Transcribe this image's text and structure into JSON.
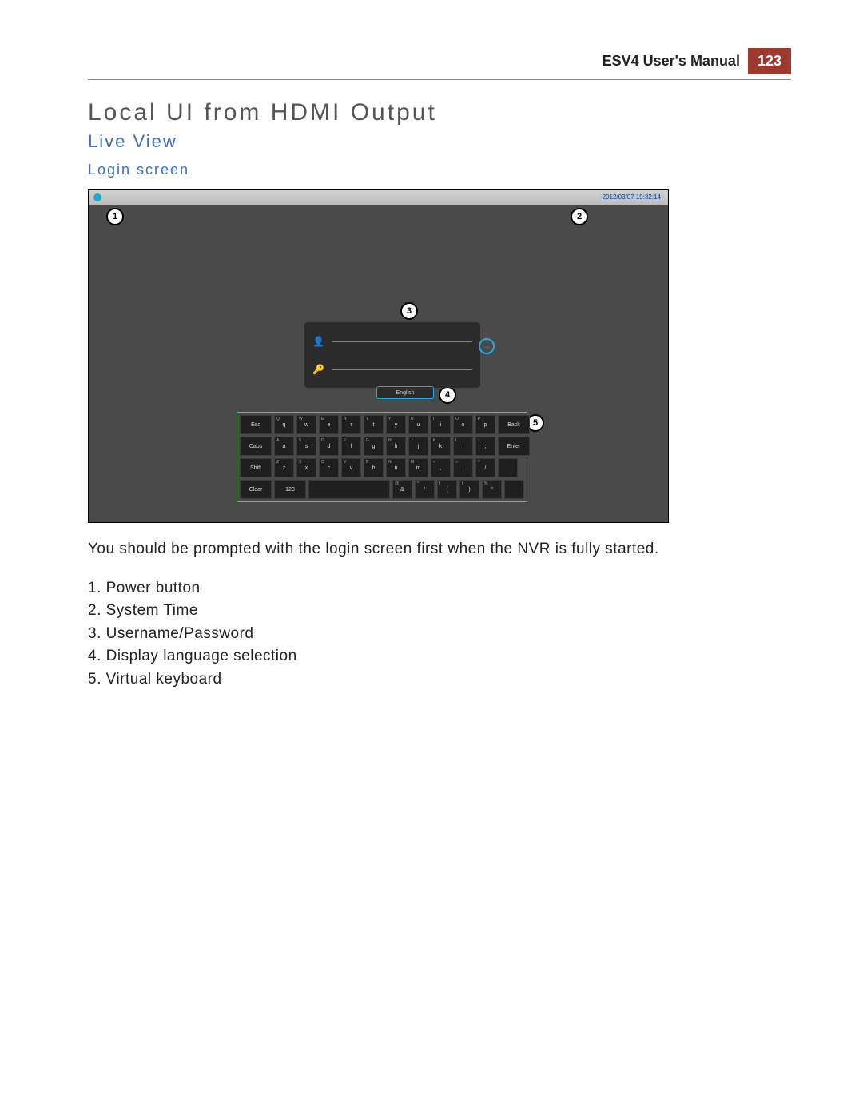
{
  "header": {
    "manual": "ESV4 User's Manual",
    "page": "123"
  },
  "titles": {
    "h1": "Local UI from HDMI Output",
    "h2": "Live View",
    "h3": "Login screen"
  },
  "screenshot": {
    "timestamp": "2012/03/07 19:32:14",
    "language": "English",
    "callouts": {
      "c1": "1",
      "c2": "2",
      "c3": "3",
      "c4": "4",
      "c5": "5"
    },
    "keyboard": {
      "row1": [
        "Esc",
        "q",
        "w",
        "e",
        "r",
        "t",
        "y",
        "u",
        "i",
        "o",
        "p",
        "Back"
      ],
      "row1_sup": [
        "",
        "Q",
        "W",
        "E",
        "R",
        "T",
        "Y",
        "U",
        "I",
        "O",
        "P",
        ""
      ],
      "row2": [
        "Caps",
        "a",
        "s",
        "d",
        "f",
        "g",
        "h",
        "j",
        "k",
        "l",
        ";",
        "Enter"
      ],
      "row2_sup": [
        "",
        "A",
        "S",
        "D",
        "F",
        "G",
        "H",
        "J",
        "K",
        "L",
        ":",
        ""
      ],
      "row3": [
        "Shift",
        "z",
        "x",
        "c",
        "v",
        "b",
        "n",
        "m",
        ",",
        ".",
        "/",
        ""
      ],
      "row3_sup": [
        "",
        "Z",
        "X",
        "C",
        "V",
        "B",
        "N",
        "M",
        "<",
        ">",
        "?",
        ""
      ],
      "row4": [
        "Clear",
        "123",
        "",
        "&",
        "'",
        "(",
        ")",
        "\"",
        ""
      ],
      "row4_sup": [
        "",
        "",
        "",
        "@",
        "*",
        "[",
        "]",
        "%",
        ""
      ]
    }
  },
  "body": "You should be prompted with the login screen first when the NVR is fully started.",
  "list": {
    "i1": "1. Power button",
    "i2": "2. System Time",
    "i3": "3. Username/Password",
    "i4": "4. Display language selection",
    "i5": "5. Virtual keyboard"
  }
}
